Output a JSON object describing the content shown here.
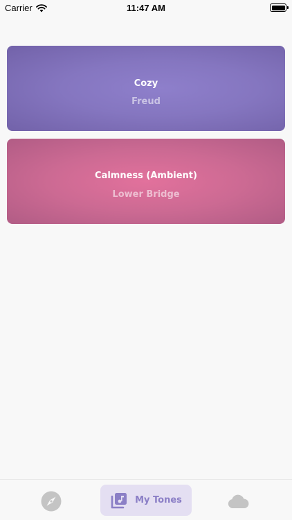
{
  "status_bar": {
    "carrier": "Carrier",
    "time": "11:47 AM",
    "icons": [
      "wifi-icon",
      "battery-icon"
    ]
  },
  "tones": [
    {
      "title": "Cozy",
      "subtitle": "Freud",
      "color": "#8576c0"
    },
    {
      "title": "Calmness (Ambient)",
      "subtitle": "Lower Bridge",
      "color": "#cc6a93"
    }
  ],
  "tab_bar": {
    "tabs": [
      {
        "id": "explore",
        "icon": "compass-icon",
        "selected": false
      },
      {
        "id": "my-tones",
        "icon": "music-library-icon",
        "label": "My Tones",
        "selected": true
      },
      {
        "id": "cloud",
        "icon": "cloud-icon",
        "selected": false
      }
    ],
    "accent_color": "#8b7fc6",
    "inactive_color": "#c4c4c4"
  }
}
